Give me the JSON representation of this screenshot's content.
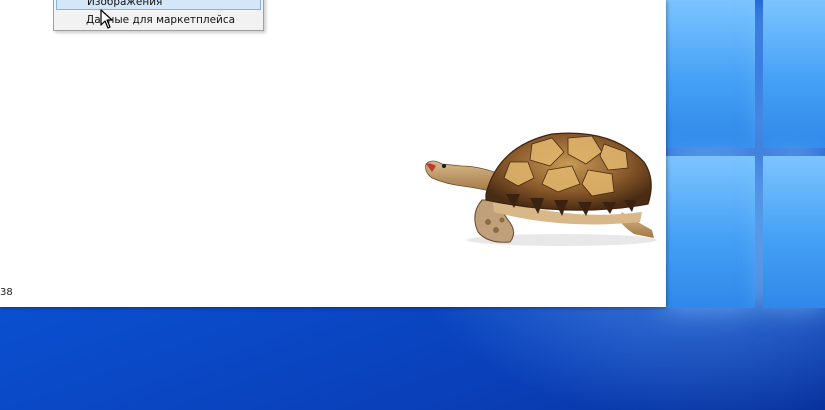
{
  "context_menu": {
    "items": [
      {
        "label": "Изображения",
        "state": "highlighted"
      },
      {
        "label": "Данные для маркетплейса",
        "state": "normal"
      }
    ]
  },
  "status": {
    "partial_number": "38"
  },
  "colors": {
    "desktop_blue": "#0a5bd6",
    "menu_highlight": "#d4e7f8",
    "window_bg": "#ffffff"
  },
  "icons": [
    "windows-logo-icon",
    "mouse-cursor-icon"
  ]
}
